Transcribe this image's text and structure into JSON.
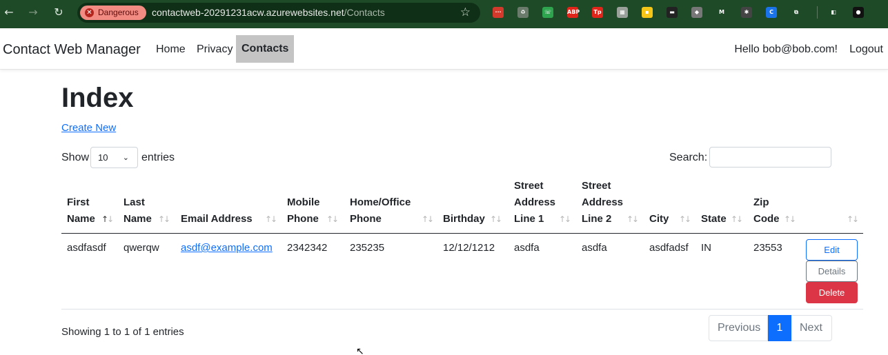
{
  "browser": {
    "security_chip": "Dangerous",
    "url_host": "contactweb-20291231acw.azurewebsites.net",
    "url_path": "/Contacts",
    "back_icon": "arrow-left-icon",
    "forward_icon": "arrow-right-icon",
    "reload_icon": "reload-icon",
    "star_icon": "star-icon",
    "extensions": [
      {
        "name": "ext-dots-icon",
        "text": "···",
        "color": "#d33a2c"
      },
      {
        "name": "ext-recycle-icon",
        "text": "♻",
        "color": "#6b7b6b"
      },
      {
        "name": "ext-phone-icon",
        "text": "☏",
        "color": "#2ea44f"
      },
      {
        "name": "ext-abp-icon",
        "text": "ABP",
        "color": "#e1251b"
      },
      {
        "name": "ext-tp-icon",
        "text": "Tp",
        "color": "#e1251b"
      },
      {
        "name": "ext-calc-icon",
        "text": "▦",
        "color": "#9aa09a"
      },
      {
        "name": "ext-note-icon",
        "text": "▪",
        "color": "#f5c518"
      },
      {
        "name": "ext-save-icon",
        "text": "▬",
        "color": "#222222"
      },
      {
        "name": "ext-diamond-icon",
        "text": "◆",
        "color": "#777777"
      },
      {
        "name": "ext-m-icon",
        "text": "M",
        "color": "#1e4a28"
      },
      {
        "name": "ext-bug-icon",
        "text": "✱",
        "color": "#444444"
      },
      {
        "name": "ext-c-icon",
        "text": "C",
        "color": "#1a73e8"
      },
      {
        "name": "ext-puzzle-icon",
        "text": "⧉",
        "color": "#1e4a28"
      },
      {
        "name": "ext-sidepanel-icon",
        "text": "◧",
        "color": "#1e4a28"
      },
      {
        "name": "profile-avatar-icon",
        "text": "●",
        "color": "#111111"
      }
    ]
  },
  "navbar": {
    "brand": "Contact Web Manager",
    "links": [
      "Home",
      "Privacy",
      "Contacts"
    ],
    "active_link": "Contacts",
    "greeting": "Hello bob@bob.com!",
    "logout": "Logout"
  },
  "main": {
    "title": "Index",
    "create_new": "Create New",
    "show_label": "Show",
    "page_length": "10",
    "entries_label": "entries",
    "search_label": "Search:",
    "search_value": ""
  },
  "table": {
    "headers": [
      {
        "lines": [
          "First",
          "Name"
        ]
      },
      {
        "lines": [
          "Last",
          "Name"
        ]
      },
      {
        "lines": [
          "",
          "Email Address"
        ]
      },
      {
        "lines": [
          "Mobile",
          "Phone"
        ]
      },
      {
        "lines": [
          "Home/Office",
          "Phone"
        ]
      },
      {
        "lines": [
          "",
          "Birthday"
        ]
      },
      {
        "lines": [
          "Street",
          "Address",
          "Line 1"
        ]
      },
      {
        "lines": [
          "Street",
          "Address",
          "Line 2"
        ]
      },
      {
        "lines": [
          "",
          "City"
        ]
      },
      {
        "lines": [
          "",
          "State"
        ]
      },
      {
        "lines": [
          "Zip",
          "Code"
        ]
      },
      {
        "lines": [
          ""
        ]
      }
    ],
    "sorted_column": "First Name",
    "rows": [
      {
        "first_name": "asdfasdf",
        "last_name": "qwerqw",
        "email": "asdf@example.com",
        "mobile": "2342342",
        "home_office": "235235",
        "birthday": "12/12/1212",
        "street1": "asdfa",
        "street2": "asdfa",
        "city": "asdfadsf",
        "state": "IN",
        "zip": "23553",
        "actions": {
          "edit": "Edit",
          "details": "Details",
          "delete": "Delete"
        }
      }
    ]
  },
  "footer": {
    "info": "Showing 1 to 1 of 1 entries",
    "previous": "Previous",
    "current_page": "1",
    "next": "Next"
  },
  "colors": {
    "primary": "#0d6efd",
    "danger": "#dc3545",
    "secondary": "#6c757d",
    "browser_frame": "#1e4a28"
  }
}
